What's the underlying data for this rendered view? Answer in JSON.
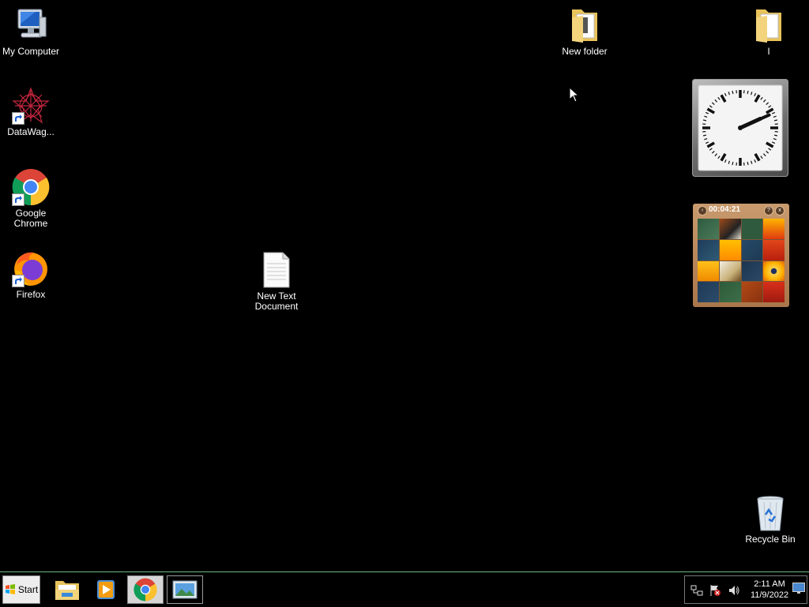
{
  "desktop": {
    "icons": [
      {
        "id": "my-computer",
        "label": "My Computer"
      },
      {
        "id": "datawag",
        "label": "DataWag..."
      },
      {
        "id": "chrome",
        "label": "Google\nChrome"
      },
      {
        "id": "firefox",
        "label": "Firefox"
      },
      {
        "id": "text-doc",
        "label": "New Text\nDocument"
      },
      {
        "id": "new-folder",
        "label": "New folder"
      },
      {
        "id": "folder-i",
        "label": "I"
      },
      {
        "id": "recycle-bin",
        "label": "Recycle Bin"
      }
    ]
  },
  "gadgets": {
    "clock": {
      "hour": 2,
      "minute": 11
    },
    "puzzle": {
      "timer": "00:04:21",
      "help_icon": "?",
      "options_icon": "x"
    }
  },
  "taskbar": {
    "start_label": "Start",
    "buttons": [
      {
        "name": "file-explorer",
        "state": "normal"
      },
      {
        "name": "media-player",
        "state": "normal"
      },
      {
        "name": "chrome",
        "state": "active"
      },
      {
        "name": "photo-viewer",
        "state": "open"
      }
    ],
    "tray": {
      "time": "2:11 AM",
      "date": "11/9/2022"
    }
  },
  "colors": {
    "taskbar_border": "#6db87c",
    "desktop_bg": "#000000"
  }
}
